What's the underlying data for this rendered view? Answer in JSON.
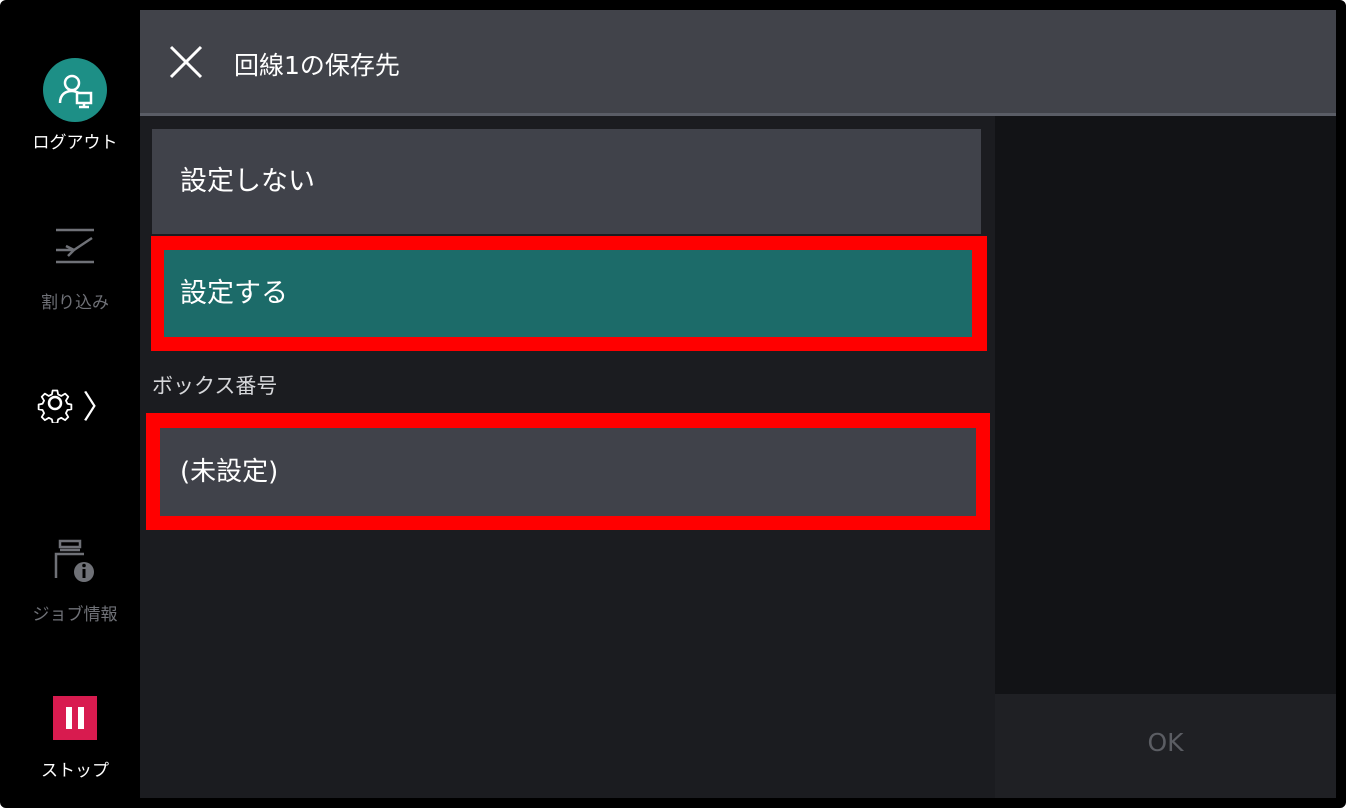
{
  "sidebar": {
    "logout_label": "ログアウト",
    "interrupt_label": "割り込み",
    "job_info_label": "ジョブ情報",
    "stop_label": "ストップ",
    "settings_chevron": "〉"
  },
  "header": {
    "title": "回線1の保存先"
  },
  "options": {
    "not_set": "設定しない",
    "set": "設定する"
  },
  "box": {
    "section_label": "ボックス番号",
    "value": "(未設定)"
  },
  "footer": {
    "ok_label": "OK"
  },
  "colors": {
    "accent_teal": "#1c6b69",
    "highlight_red": "#ff0000",
    "stop_red": "#d81b4f"
  }
}
